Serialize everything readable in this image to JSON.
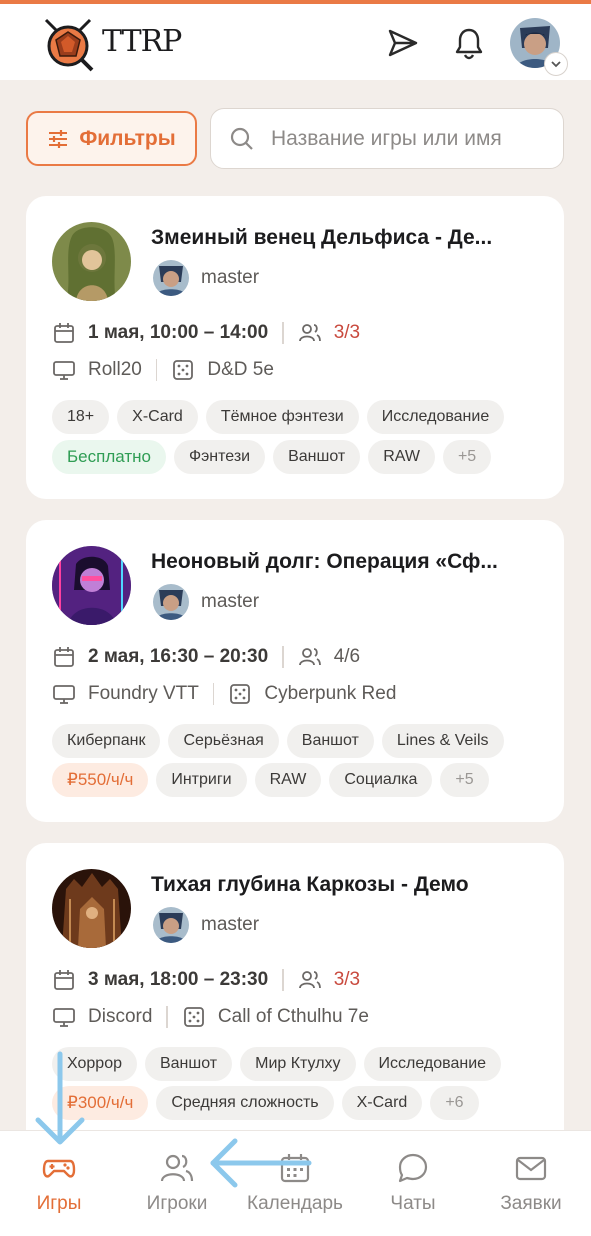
{
  "header": {
    "logo_text": "TTRP",
    "icons": [
      "send-icon",
      "bell-icon",
      "user-avatar"
    ]
  },
  "filters": {
    "label": "Фильтры"
  },
  "search": {
    "placeholder": "Название игры или имя"
  },
  "games": [
    {
      "title": "Змеиный венец Дельфиса - Де...",
      "master": "master",
      "date": "1 мая, 10:00 – 14:00",
      "players": "3/3",
      "players_full": true,
      "platform": "Roll20",
      "system": "D&D 5e",
      "tags_row1": [
        "18+",
        "X-Card",
        "Тёмное фэнтези",
        "Исследование"
      ],
      "price": "Бесплатно",
      "price_type": "free",
      "tags_row2": [
        "Фэнтези",
        "Ваншот",
        "RAW"
      ],
      "more": "+5"
    },
    {
      "title": "Неоновый долг: Операция «Сф...",
      "master": "master",
      "date": "2 мая, 16:30 – 20:30",
      "players": "4/6",
      "players_full": false,
      "platform": "Foundry VTT",
      "system": "Cyberpunk Red",
      "tags_row1": [
        "Киберпанк",
        "Серьёзная",
        "Ваншот",
        "Lines & Veils"
      ],
      "price": "₽550/ч/ч",
      "price_type": "paid",
      "tags_row2": [
        "Интриги",
        "RAW",
        "Социалка"
      ],
      "more": "+5"
    },
    {
      "title": "Тихая глубина Каркозы - Демо",
      "master": "master",
      "date": "3 мая, 18:00 – 23:30",
      "players": "3/3",
      "players_full": true,
      "platform": "Discord",
      "system": "Call of Cthulhu 7e",
      "tags_row1": [
        "Хоррор",
        "Ваншот",
        "Мир Ктулху",
        "Исследование"
      ],
      "price": "₽300/ч/ч",
      "price_type": "paid",
      "tags_row2": [
        "Средняя сложность",
        "X-Card"
      ],
      "more": "+6"
    }
  ],
  "nav": {
    "items": [
      {
        "label": "Игры",
        "icon": "gamepad-icon",
        "active": true
      },
      {
        "label": "Игроки",
        "icon": "users-icon",
        "active": false
      },
      {
        "label": "Календарь",
        "icon": "calendar-icon",
        "active": false
      },
      {
        "label": "Чаты",
        "icon": "chat-icon",
        "active": false
      },
      {
        "label": "Заявки",
        "icon": "mail-icon",
        "active": false
      }
    ]
  },
  "colors": {
    "accent": "#ea7a45",
    "background": "#f3eeea",
    "free_green": "#2f9d54",
    "full_red": "#c94a3e",
    "arrow_blue": "#8cc8ec"
  }
}
